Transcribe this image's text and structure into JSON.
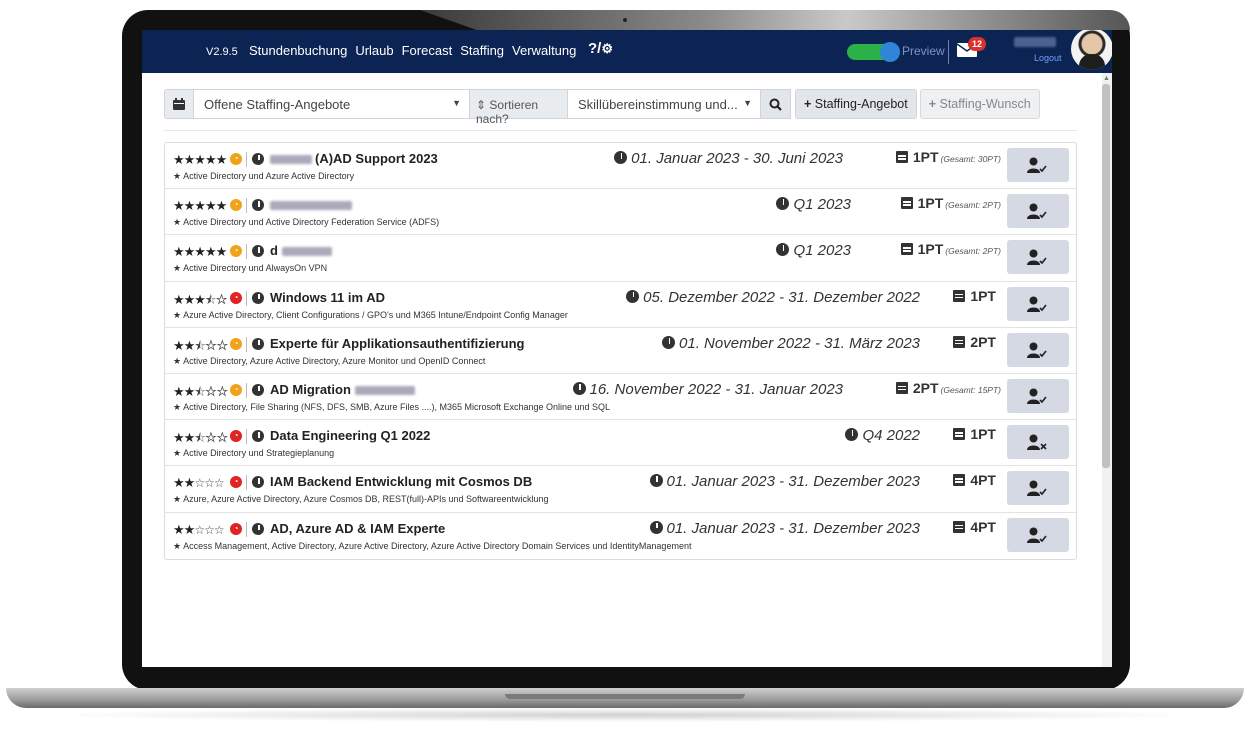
{
  "nav": {
    "version": "V2.9.5",
    "menu": [
      "Stundenbuchung",
      "Urlaub",
      "Forecast",
      "Staffing",
      "Verwaltung"
    ],
    "help": "?/",
    "preview_label": "Preview",
    "mail_badge": "12",
    "logout": "Logout"
  },
  "toolbar": {
    "filter_select": "Offene Staffing-Angebote",
    "sort_label": "Sortieren nach?",
    "sort_select": "Skillübereinstimmung und...",
    "add_offer": "Staffing-Angebot",
    "add_wish": "Staffing-Wunsch"
  },
  "rows": [
    {
      "rating": 5,
      "status": "orange",
      "title": "(A)AD Support 2023",
      "skills": "Active Directory und Azure Active Directory",
      "date": "01. Januar 2023 - 30. Juni 2023",
      "pt": "1PT",
      "gesamt": "(Gesamt: 30PT)",
      "action": "user-check"
    },
    {
      "rating": 5,
      "status": "orange",
      "title": "",
      "skills": "Active Directory und Active Directory Federation Service (ADFS)",
      "date": "Q1 2023",
      "pt": "1PT",
      "gesamt": "(Gesamt: 2PT)",
      "action": "user-check"
    },
    {
      "rating": 5,
      "status": "orange",
      "title": "d",
      "skills": "Active Directory und AlwaysOn VPN",
      "date": "Q1 2023",
      "pt": "1PT",
      "gesamt": "(Gesamt: 2PT)",
      "action": "user-check"
    },
    {
      "rating": 3.5,
      "status": "red",
      "title": "Windows 11 im AD",
      "skills": "Azure Active Directory, Client Configurations / GPO's und M365 Intune/Endpoint Config Manager",
      "date": "05. Dezember 2022 - 31. Dezember 2022",
      "pt": "1PT",
      "gesamt": "",
      "action": "user-check"
    },
    {
      "rating": 2.5,
      "status": "orange",
      "title": "Experte für Applikationsauthentifizierung",
      "skills": "Active Directory, Azure Active Directory, Azure Monitor und OpenID Connect",
      "date": "01. November 2022 - 31. März 2023",
      "pt": "2PT",
      "gesamt": "",
      "action": "user-check"
    },
    {
      "rating": 2.5,
      "status": "orange",
      "title": "AD Migration",
      "skills": "Active Directory, File Sharing (NFS, DFS, SMB, Azure Files ....), M365 Microsoft Exchange Online und SQL",
      "date": "16. November 2022 - 31. Januar 2023",
      "pt": "2PT",
      "gesamt": "(Gesamt: 15PT)",
      "action": "user-check"
    },
    {
      "rating": 2.5,
      "status": "red",
      "title": "Data Engineering Q1 2022",
      "skills": "Active Directory und Strategieplanung",
      "date": "Q4 2022",
      "pt": "1PT",
      "gesamt": "",
      "action": "user-times"
    },
    {
      "rating": 2,
      "status": "red",
      "title": "IAM Backend Entwicklung mit Cosmos DB",
      "skills": "Azure, Azure Active Directory, Azure Cosmos DB, REST(full)-APIs und Softwareentwicklung",
      "date": "01. Januar 2023 - 31. Dezember 2023",
      "pt": "4PT",
      "gesamt": "",
      "action": "user-check"
    },
    {
      "rating": 2,
      "status": "red",
      "title": "AD, Azure AD & IAM Experte",
      "skills": "Access Management, Active Directory, Azure Active Directory, Azure Active Directory Domain Services und IdentityManagement",
      "date": "01. Januar 2023 - 31. Dezember 2023",
      "pt": "4PT",
      "gesamt": "",
      "action": "user-check"
    }
  ],
  "colors": {
    "navbar": "#0c2454",
    "orange": "#f0a21b",
    "red": "#e02424",
    "toggle": "#2bb04a"
  }
}
